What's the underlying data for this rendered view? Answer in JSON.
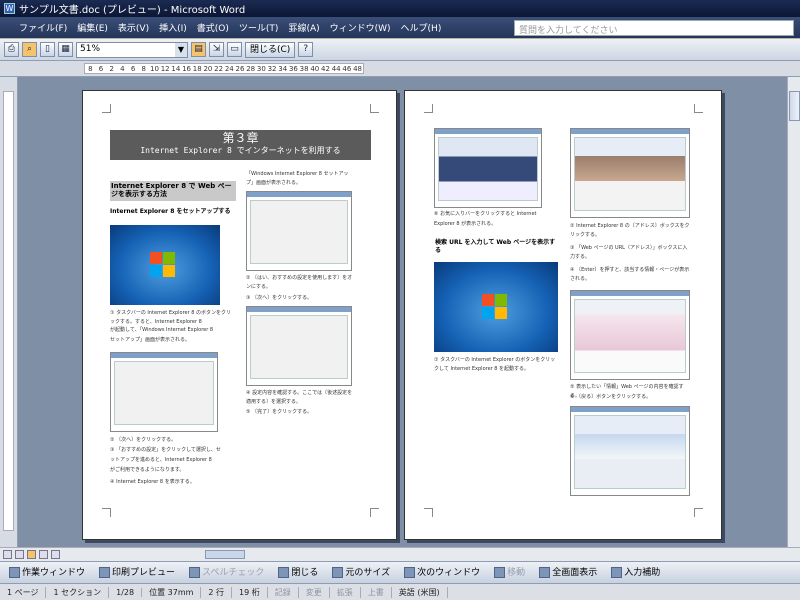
{
  "window": {
    "title": "サンプル文書.doc (プレビュー) - Microsoft Word"
  },
  "menu": {
    "items": [
      "ファイル(F)",
      "編集(E)",
      "表示(V)",
      "挿入(I)",
      "書式(O)",
      "ツール(T)",
      "罫線(A)",
      "ウィンドウ(W)",
      "ヘルプ(H)"
    ],
    "help_placeholder": "質問を入力してください"
  },
  "toolbar": {
    "zoom": "51%",
    "close_label": "閉じる(C)"
  },
  "ruler": {
    "ticks": [
      "8",
      "6",
      "2",
      "4",
      "6",
      "8",
      "10",
      "12",
      "14",
      "16",
      "18",
      "20",
      "22",
      "24",
      "26",
      "28",
      "30",
      "32",
      "34",
      "36",
      "38",
      "40",
      "42",
      "44",
      "46",
      "48"
    ]
  },
  "page1": {
    "chapter": "第３章",
    "chapter_sub": "Internet Explorer 8 でインターネットを利用する",
    "section1": "Internet Explorer 8 で Web ページを表示する方法",
    "section1b": "Internet Explorer 8 をセットアップする",
    "left_texts": [
      "① タスクバーの Internet Explorer 8 のボタンをクリックする。すると、Internet Explorer 8",
      "が起動して、「Windows Internet Explorer 8",
      "セットアップ」画面が表示される。",
      "② 〔次へ〕をクリックする。",
      "③ 「おすすめの設定」をクリックして選択し、セ",
      "ットアップを進めると、Internet Explorer 8",
      "がご利用できるようになります。",
      "④ Internet Explorer 8 を表示する。"
    ],
    "right_texts": [
      "「Windows Internet Explorer 8 セットアップ」画面が表示される。",
      "② 〔はい、おすすめの設定を使用します〕をオンにする。",
      "③ 〔次へ〕をクリックする。",
      "④ 設定内容を確認する。ここでは〔後述設定を適用する〕を選択する。",
      "⑤ 〔完了〕をクリックする。"
    ]
  },
  "page2": {
    "left_texts": [
      "⑥ お気に入りバーをクリックすると Internet",
      "Explorer 8 が表示される。"
    ],
    "section2": "検索 URL を入力して Web ページを表示する",
    "caption2": "① タスクバーの Internet Explorer のボタンをクリックして Internet Explorer 8 を起動する。",
    "right_texts": [
      "② Internet Explorer 8 の〔アドレス〕ボックスをクリックする。",
      "③ 「Web ページの URL（アドレス）」ボックスに入力する。",
      "④ 〔Enter〕を押すと、該当する情報・ページが表示される。",
      "⑤ 表示したい「情報」Web ページの内容を確認する。",
      "⑥ 〔戻る〕ボタンをクリックする。"
    ]
  },
  "drawbar": {
    "items": [
      {
        "label": "作業ウィンドウ",
        "disabled": false
      },
      {
        "label": "印刷プレビュー",
        "disabled": false
      },
      {
        "label": "スペルチェック",
        "disabled": true
      },
      {
        "label": "閉じる",
        "disabled": false
      },
      {
        "label": "元のサイズ",
        "disabled": false
      },
      {
        "label": "次のウィンドウ",
        "disabled": false
      },
      {
        "label": "移動",
        "disabled": true
      },
      {
        "label": "全画面表示",
        "disabled": false
      },
      {
        "label": "入力補助",
        "disabled": false
      }
    ]
  },
  "status": {
    "page": "1 ページ",
    "section": "1 セクション",
    "pages": "1/28",
    "position": "位置 37mm",
    "line": "2 行",
    "col": "19 桁",
    "rec": "記録",
    "trk": "変更",
    "ext": "拡張",
    "ovr": "上書",
    "lang": "英語 (米国)"
  }
}
